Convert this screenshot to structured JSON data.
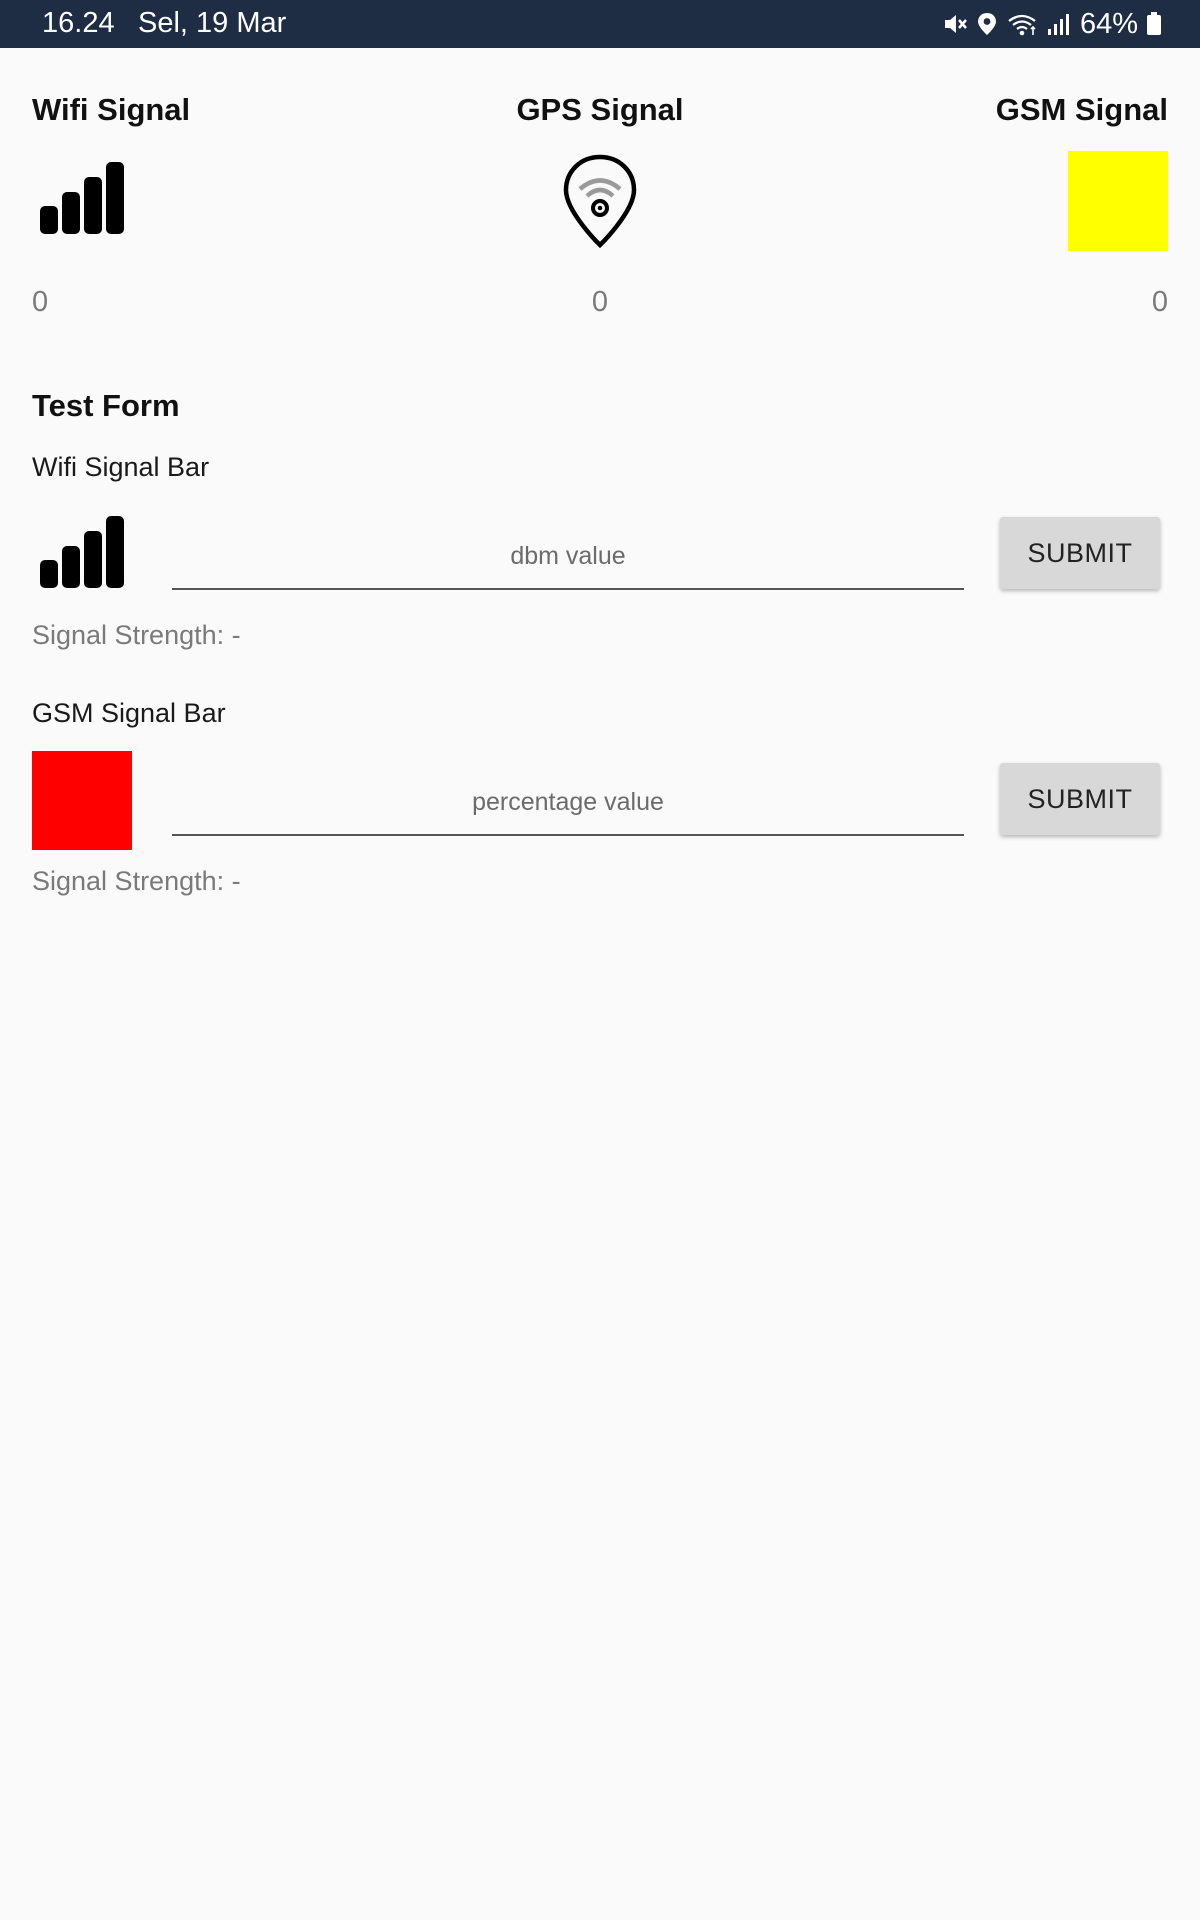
{
  "status_bar": {
    "time": "16.24",
    "date": "Sel, 19 Mar",
    "battery": "64%",
    "icons": [
      "mute-icon",
      "location-icon",
      "wifi-icon",
      "cell-signal-icon",
      "battery-icon"
    ]
  },
  "header": {
    "wifi": {
      "title": "Wifi Signal",
      "value": "0",
      "icon": "signal-bars-icon"
    },
    "gps": {
      "title": "GPS Signal",
      "value": "0",
      "icon": "gps-pin-icon"
    },
    "gsm": {
      "title": "GSM Signal",
      "value": "0",
      "color": "#ffff00"
    }
  },
  "test_form": {
    "title": "Test Form",
    "wifi": {
      "label": "Wifi Signal Bar",
      "placeholder": "dbm value",
      "submit_label": "SUBMIT",
      "strength": "Signal Strength: -",
      "icon": "signal-bars-icon"
    },
    "gsm": {
      "label": "GSM Signal Bar",
      "placeholder": "percentage value",
      "submit_label": "SUBMIT",
      "strength": "Signal Strength: -",
      "color": "#ff0000"
    }
  },
  "colors": {
    "status_bar_bg": "#1e2d44",
    "background": "#fafafa",
    "button_bg": "#d8d8d8"
  }
}
